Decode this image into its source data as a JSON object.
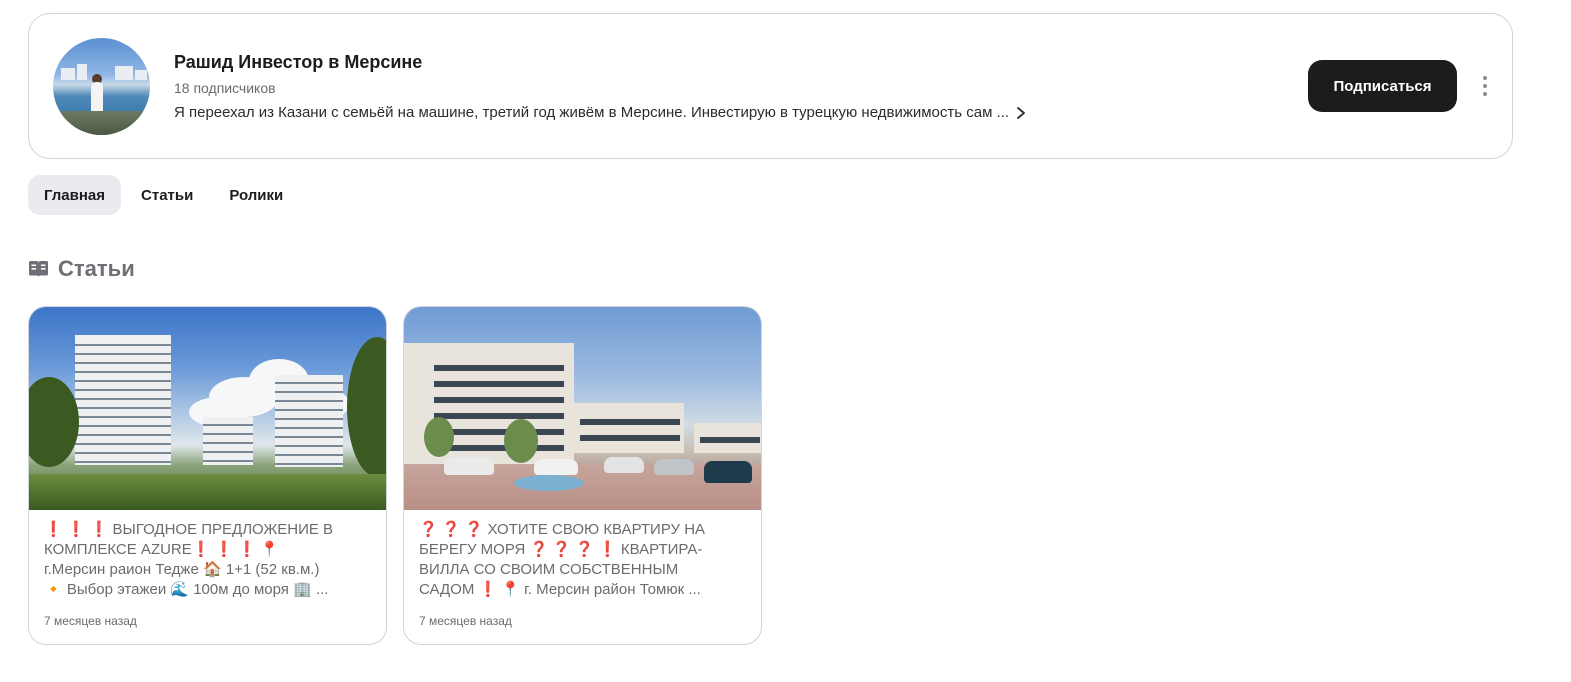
{
  "channel": {
    "name": "Рашид Инвестор в Мерсине",
    "subscribers": "18 подписчиков",
    "description": "Я переехал из Казани с семьёй на машине, третий год живём в Мерсине. Инвестирую в турецкую недвижимость сам ...",
    "subscribe_label": "Подписаться"
  },
  "tabs": [
    {
      "label": "Главная",
      "active": true
    },
    {
      "label": "Статьи",
      "active": false
    },
    {
      "label": "Ролики",
      "active": false
    }
  ],
  "section": {
    "title": "Статьи",
    "icon": "book-open-icon"
  },
  "articles": [
    {
      "lines": [
        "❗ ❗ ❗ ВЫГОДНОЕ ПРЕДЛОЖЕНИЕ В",
        "КОМПЛЕКСЕ AZURE❗ ❗ ❗ 📍",
        "г.Мерсин раион Тедже 🏠 1+1 (52 кв.м.)",
        "🔸 Выбор этажеи 🌊 100м до моря 🏢 ..."
      ],
      "age": "7 месяцев назад"
    },
    {
      "lines": [
        "❓ ❓ ❓ ХОТИТЕ СВОЮ КВАРТИРУ НА",
        "БЕРЕГУ МОРЯ ❓ ❓ ❓ ❗ КВАРТИРА-",
        "ВИЛЛА СО СВОИМ СОБСТВЕННЫМ",
        "САДОМ ❗ 📍 г. Мерсин район Томюк ..."
      ],
      "age": "7 месяцев назад"
    }
  ],
  "colors": {
    "button_bg": "#1c1c1e",
    "active_tab_bg": "#ebebef",
    "muted_text": "#6b6b70",
    "border": "#d4d4d8"
  }
}
